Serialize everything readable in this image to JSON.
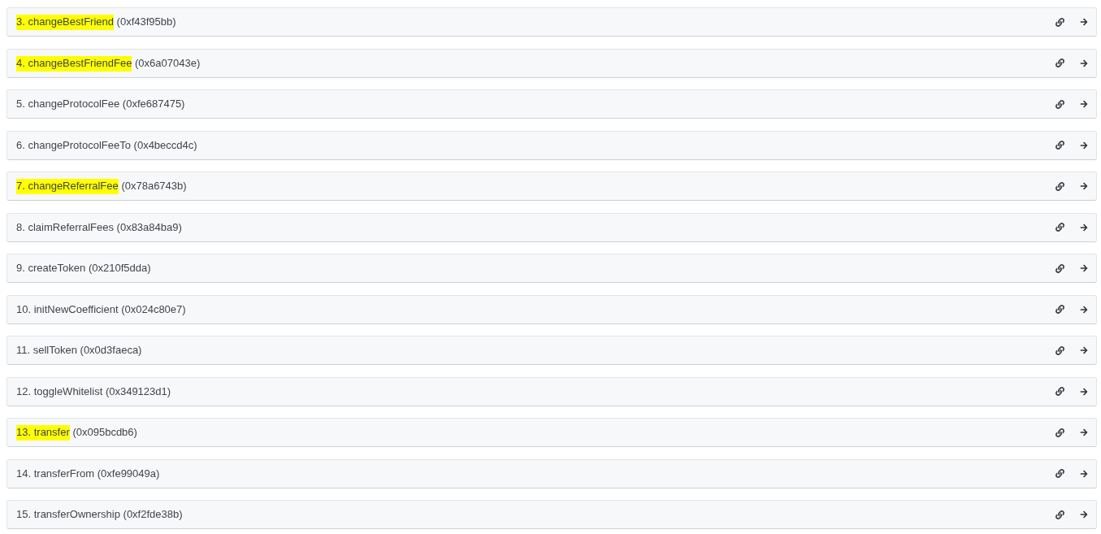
{
  "rows": [
    {
      "number": "3.",
      "name": "changeBestFriend",
      "selector": "(0xf43f95bb)",
      "highlighted": true
    },
    {
      "number": "4.",
      "name": "changeBestFriendFee",
      "selector": "(0x6a07043e)",
      "highlighted": true
    },
    {
      "number": "5.",
      "name": "changeProtocolFee",
      "selector": "(0xfe687475)",
      "highlighted": false
    },
    {
      "number": "6.",
      "name": "changeProtocolFeeTo",
      "selector": "(0x4beccd4c)",
      "highlighted": false
    },
    {
      "number": "7.",
      "name": "changeReferralFee",
      "selector": "(0x78a6743b)",
      "highlighted": true
    },
    {
      "number": "8.",
      "name": "claimReferralFees",
      "selector": "(0x83a84ba9)",
      "highlighted": false
    },
    {
      "number": "9.",
      "name": "createToken",
      "selector": "(0x210f5dda)",
      "highlighted": false
    },
    {
      "number": "10.",
      "name": "initNewCoefficient",
      "selector": "(0x024c80e7)",
      "highlighted": false
    },
    {
      "number": "11.",
      "name": "sellToken",
      "selector": "(0x0d3faeca)",
      "highlighted": false
    },
    {
      "number": "12.",
      "name": "toggleWhitelist",
      "selector": "(0x349123d1)",
      "highlighted": false
    },
    {
      "number": "13.",
      "name": "transfer",
      "selector": "(0x095bcdb6)",
      "highlighted": true
    },
    {
      "number": "14.",
      "name": "transferFrom",
      "selector": "(0xfe99049a)",
      "highlighted": false
    },
    {
      "number": "15.",
      "name": "transferOwnership",
      "selector": "(0xf2fde38b)",
      "highlighted": false
    }
  ]
}
